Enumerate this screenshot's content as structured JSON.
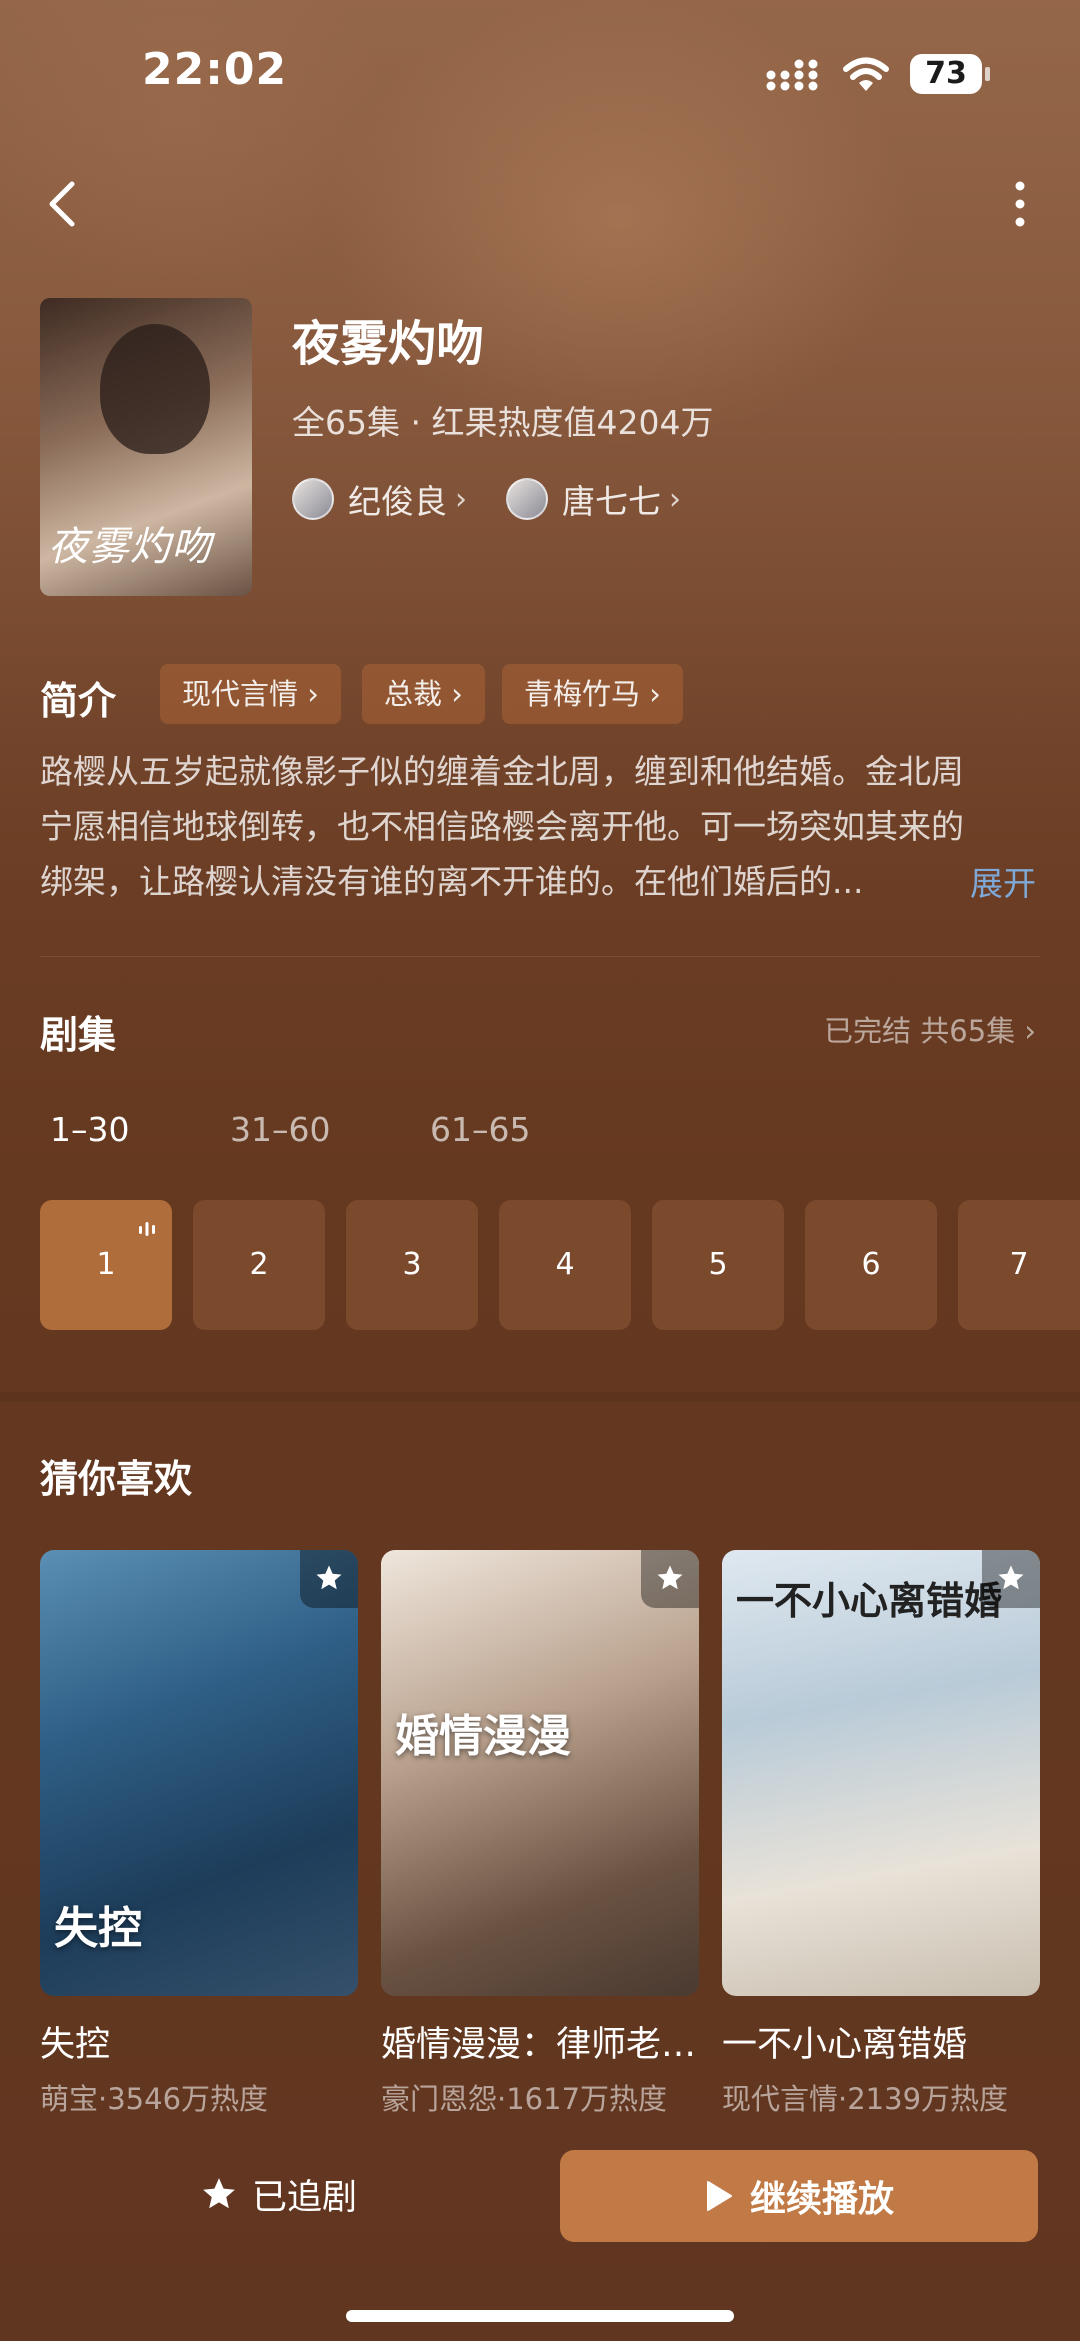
{
  "status_bar": {
    "time": "22:02",
    "battery": "73"
  },
  "header": {
    "title": "夜雾灼吻",
    "meta": "全65集 · 红果热度值4204万",
    "poster_title": "夜雾灼吻",
    "actors": [
      {
        "name": "纪俊良"
      },
      {
        "name": "唐七七"
      }
    ]
  },
  "synopsis": {
    "title": "简介",
    "tags": [
      "现代言情",
      "总裁",
      "青梅竹马"
    ],
    "lines": [
      "路樱从五岁起就像影子似的缠着金北周，缠到和他结婚。金北周",
      "宁愿相信地球倒转，也不相信路樱会离开他。可一场突如其来的",
      "绑架，让路樱认清没有谁的离不开谁的。在他们婚后的..."
    ],
    "expand": "展开"
  },
  "episodes": {
    "title": "剧集",
    "status": "已完结 共65集",
    "ranges": [
      "1–30",
      "31–60",
      "61–65"
    ],
    "items": [
      "1",
      "2",
      "3",
      "4",
      "5",
      "6",
      "7"
    ]
  },
  "recommend": {
    "title": "猜你喜欢",
    "items": [
      {
        "name": "失控",
        "sub": "萌宝·3546万热度",
        "overlay": "失控"
      },
      {
        "name": "婚情漫漫：律师老…",
        "sub": "豪门恩怨·1617万热度",
        "overlay": "婚情漫漫"
      },
      {
        "name": "一不小心离错婚",
        "sub": "现代言情·2139万热度",
        "overlay": "一不小心离错婚"
      }
    ]
  },
  "bottom": {
    "follow_label": "已追剧",
    "play_label": "继续播放"
  },
  "colors": {
    "accent": "#c17a45",
    "active_tile": "#b06d3c",
    "link": "#7fa8d6"
  }
}
